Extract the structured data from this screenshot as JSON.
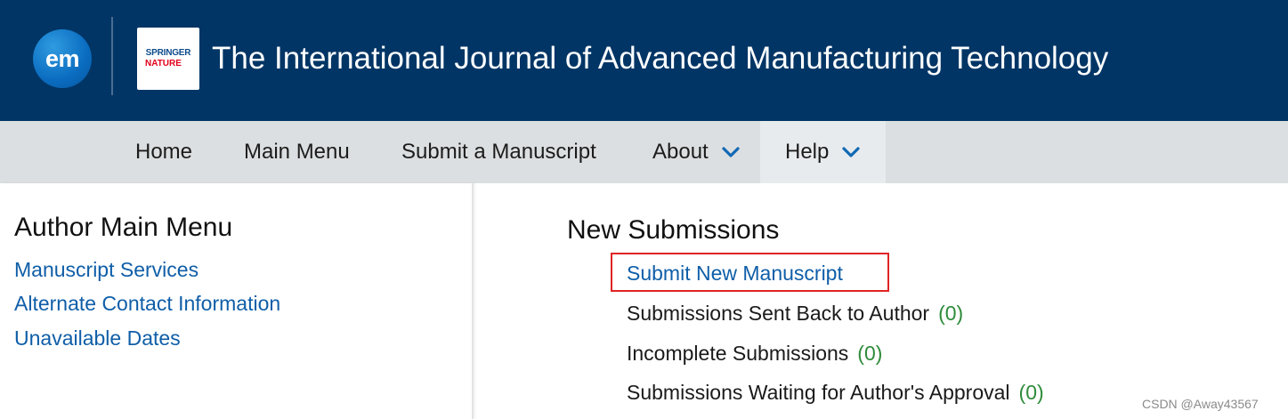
{
  "header": {
    "em_logo_text": "em",
    "publisher_logo_line1": "SPRINGER",
    "publisher_logo_line2": "NATURE",
    "journal_title": "The International Journal of Advanced Manufacturing Technology"
  },
  "nav": {
    "items": [
      {
        "label": "Home",
        "has_dropdown": false
      },
      {
        "label": "Main Menu",
        "has_dropdown": false
      },
      {
        "label": "Submit a Manuscript",
        "has_dropdown": false
      },
      {
        "label": "About",
        "has_dropdown": true
      },
      {
        "label": "Help",
        "has_dropdown": true
      }
    ]
  },
  "author_menu": {
    "heading": "Author Main Menu",
    "links": [
      "Manuscript Services",
      "Alternate Contact Information",
      "Unavailable Dates"
    ]
  },
  "new_submissions": {
    "heading": "New Submissions",
    "submit_link": "Submit New Manuscript",
    "items": [
      {
        "label": "Submissions Sent Back to Author",
        "count": "(0)"
      },
      {
        "label": "Incomplete Submissions",
        "count": "(0)"
      },
      {
        "label": "Submissions Waiting for Author's Approval",
        "count": "(0)"
      }
    ]
  },
  "watermark": "CSDN @Away43567",
  "colors": {
    "header_bg": "#003565",
    "nav_bg": "#dcdfe1",
    "link": "#0f5ea8",
    "count": "#2e8b3a",
    "highlight": "#e02424"
  }
}
